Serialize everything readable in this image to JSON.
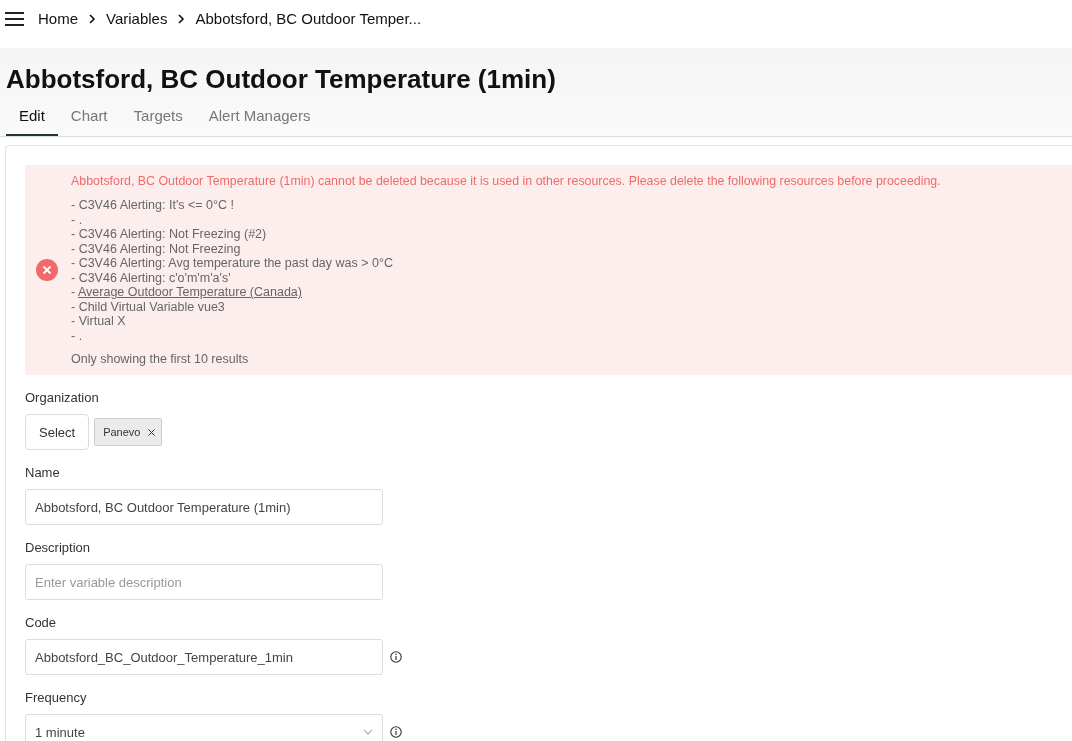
{
  "breadcrumb": [
    "Home",
    "Variables",
    "Abbotsford, BC Outdoor Temper..."
  ],
  "page_title": "Abbotsford, BC Outdoor Temperature (1min)",
  "tabs": [
    {
      "label": "Edit",
      "selected": true
    },
    {
      "label": "Chart",
      "selected": false
    },
    {
      "label": "Targets",
      "selected": false
    },
    {
      "label": "Alert Managers",
      "selected": false
    }
  ],
  "error_alert": {
    "message": "Abbotsford, BC Outdoor Temperature (1min) cannot be deleted because it is used in other resources. Please delete the following resources before proceeding.",
    "items": [
      {
        "bullet": "-",
        "text": "C3V46 Alerting: It's <= 0°C !",
        "kind": "plain"
      },
      {
        "bullet": "-",
        "text": ".",
        "kind": "plain"
      },
      {
        "bullet": "-",
        "text": "C3V46 Alerting: Not Freezing (#2)",
        "kind": "plain"
      },
      {
        "bullet": "-",
        "text": "C3V46 Alerting: Not Freezing",
        "kind": "plain"
      },
      {
        "bullet": "-",
        "text": "C3V46 Alerting: Avg temperature the past day was > 0°C",
        "kind": "plain"
      },
      {
        "bullet": "-",
        "text": "C3V46 Alerting: c'o'm'm'a's'",
        "kind": "plain"
      },
      {
        "bullet": "-",
        "text": "Average Outdoor Temperature (Canada)",
        "kind": "link"
      },
      {
        "bullet": "-",
        "text": "Child Virtual Variable vue3",
        "kind": "plain"
      },
      {
        "bullet": "-",
        "text": "Virtual X",
        "kind": "plain"
      },
      {
        "bullet": "-",
        "text": ".",
        "kind": "plain"
      }
    ],
    "footer": "Only showing the first 10 results"
  },
  "fields": [
    {
      "kind": "chips",
      "label": "Organization",
      "button": "Select",
      "chips": [
        "Panevo"
      ]
    },
    {
      "kind": "text",
      "label": "Name",
      "value": "Abbotsford, BC Outdoor Temperature (1min)",
      "info": false
    },
    {
      "kind": "text",
      "label": "Description",
      "placeholder": "Enter variable description",
      "info": false
    },
    {
      "kind": "text",
      "label": "Code",
      "value": "Abbotsford_BC_Outdoor_Temperature_1min",
      "info": true
    },
    {
      "kind": "select",
      "label": "Frequency",
      "value": "1 minute",
      "info": true
    }
  ]
}
